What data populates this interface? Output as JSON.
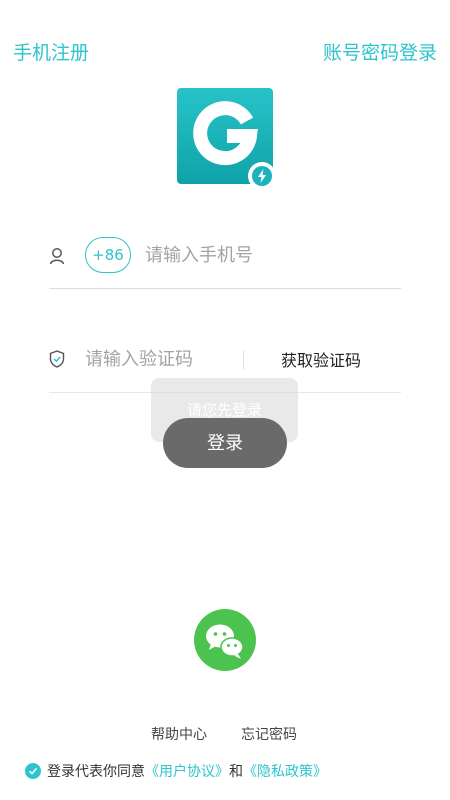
{
  "header": {
    "register_label": "手机注册",
    "password_login_label": "账号密码登录"
  },
  "phone": {
    "country_code": "+86",
    "placeholder": "请输入手机号"
  },
  "code": {
    "placeholder": "请输入验证码",
    "get_code_label": "获取验证码"
  },
  "toast": {
    "message": "请您先登录"
  },
  "login_button": {
    "label": "登录"
  },
  "footer": {
    "help_label": "帮助中心",
    "forgot_label": "忘记密码"
  },
  "agreement": {
    "prefix": "登录代表你同意",
    "user_agreement": "《用户协议》",
    "and": "和",
    "privacy_policy": "《隐私政策》"
  },
  "colors": {
    "accent": "#2cc5cd",
    "wechat_green": "#4cc34e",
    "button_gray": "#6a6a6a"
  },
  "icons": {
    "logo": "app-logo-g-icon",
    "badge": "lightning-badge-icon",
    "user": "user-icon",
    "shield": "shield-icon",
    "wechat": "wechat-icon",
    "check": "check-circle-icon"
  }
}
